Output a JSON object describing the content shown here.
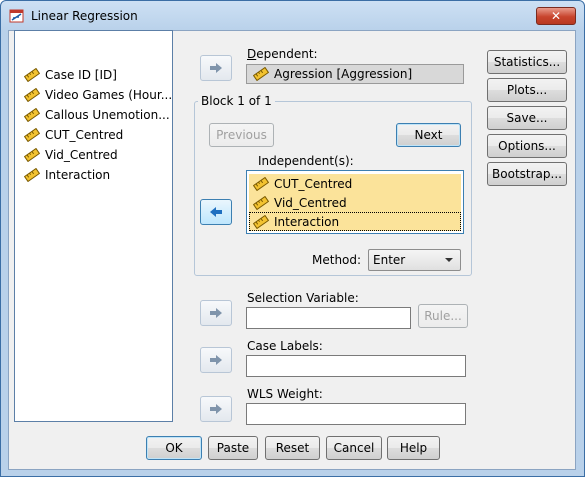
{
  "window": {
    "title": "Linear Regression",
    "close_symbol": "✕"
  },
  "variables": [
    {
      "label": "Case ID [ID]",
      "icon": "ruler-icon"
    },
    {
      "label": "Video Games (Hour...",
      "icon": "ruler-icon"
    },
    {
      "label": "Callous Unemotion...",
      "icon": "ruler-icon"
    },
    {
      "label": "CUT_Centred",
      "icon": "ruler-icon"
    },
    {
      "label": "Vid_Centred",
      "icon": "ruler-icon"
    },
    {
      "label": "Interaction",
      "icon": "ruler-icon"
    }
  ],
  "dependent": {
    "label_prefix": "D",
    "label_rest": "ependent:",
    "value": "Agression [Aggression]"
  },
  "block": {
    "title": "Block 1 of 1",
    "previous_label": "Previous",
    "next_label": "Next",
    "independent_label": "Independent(s):",
    "independents": [
      "CUT_Centred",
      "Vid_Centred",
      "Interaction"
    ],
    "method_label": "Method:",
    "method_value": "Enter"
  },
  "selection_variable": {
    "label": "Selection Variable:",
    "value": "",
    "rule_label": "Rule..."
  },
  "case_labels": {
    "label": "Case Labels:",
    "value": ""
  },
  "wls_weight": {
    "label": "WLS Weight:",
    "value": ""
  },
  "side_buttons": [
    "Statistics...",
    "Plots...",
    "Save...",
    "Options...",
    "Bootstrap..."
  ],
  "bottom_buttons": [
    "OK",
    "Paste",
    "Reset",
    "Cancel",
    "Help"
  ],
  "colors": {
    "selected_item": "#fbe39a",
    "window_frame": "#b9d1ea",
    "client": "#f0f0f0",
    "close_button": "#c8442d"
  }
}
